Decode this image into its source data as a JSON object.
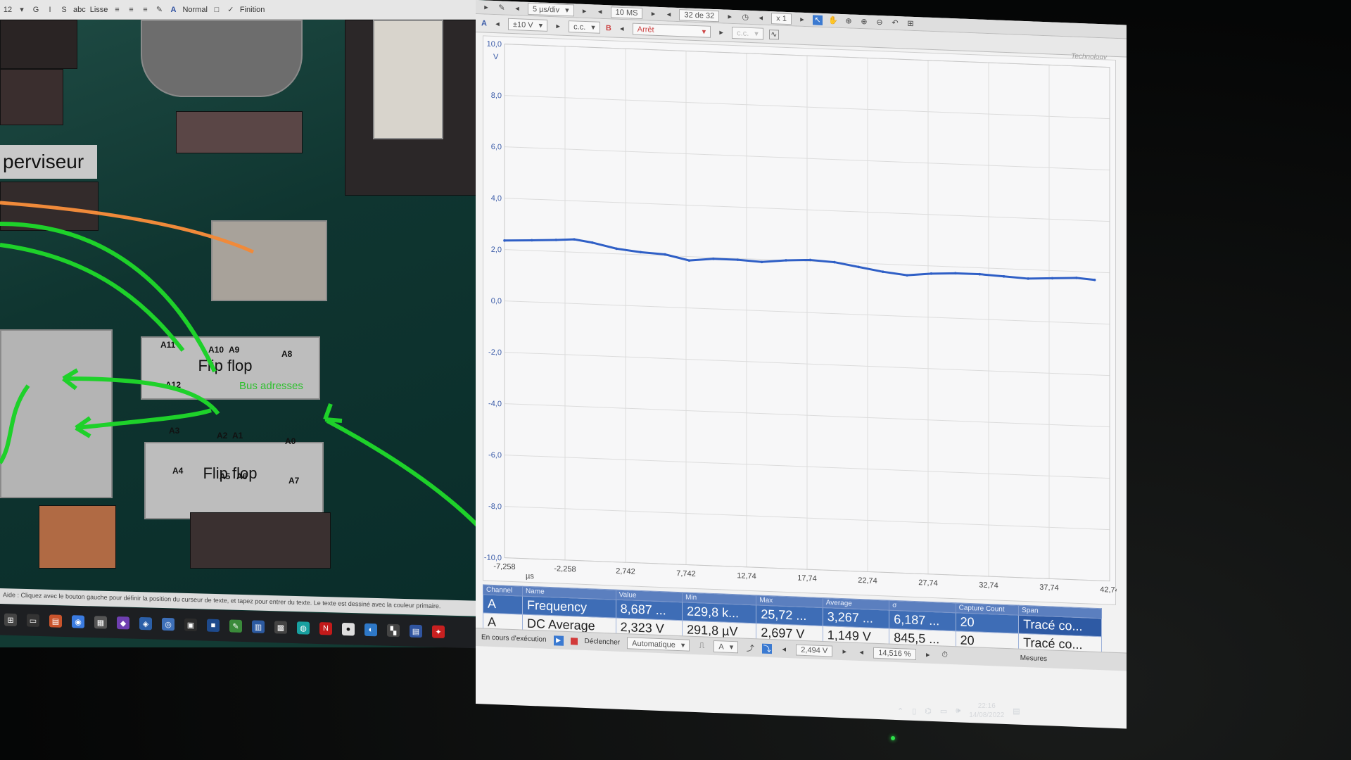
{
  "editor": {
    "toolbar": {
      "size_field": "12",
      "bold": "G",
      "italic": "I",
      "strike": "S",
      "abc": "abc",
      "smooth_label": "Lisse",
      "style_label": "Normal",
      "finish_label": "Finition"
    },
    "labels": {
      "supervisor": "perviseur",
      "flipflop_top": "Flip flop",
      "flipflop_bottom": "Flip flop",
      "bus": "Bus adresses"
    },
    "pins": [
      "A11",
      "A10",
      "A9",
      "A8",
      "A12",
      "A3",
      "A2",
      "A1",
      "A0",
      "A4",
      "A5",
      "A6",
      "A7"
    ],
    "status_text": "Aide : Cliquez avec le bouton gauche pour définir la position du curseur de texte, et tapez pour entrer du texte. Le texte est dessiné avec la couleur primaire."
  },
  "scope": {
    "toolbar1": {
      "timebase": "5 µs/div",
      "samples": "10 MS",
      "buffer": "32 de 32",
      "zoom": "x 1"
    },
    "toolbar2": {
      "channel_a": "A",
      "range_a": "±10 V",
      "coupling_a": "c.c.",
      "channel_b": "B",
      "range_b": "Arrêt",
      "coupling_b": "c.c."
    },
    "brand": "Technology",
    "chart_data": {
      "type": "line",
      "yunit": "V",
      "xunit": "µs",
      "ylim": [
        -10,
        10
      ],
      "yticks": [
        "10,0",
        "8,0",
        "6,0",
        "4,0",
        "2,0",
        "0,0",
        "-2,0",
        "-4,0",
        "-6,0",
        "-8,0",
        "-10,0"
      ],
      "xlim": [
        -7.258,
        42.74
      ],
      "xticks": [
        "-7,258",
        "-2,258",
        "2,742",
        "7,742",
        "12,74",
        "17,74",
        "22,74",
        "27,74",
        "32,74",
        "37,74",
        "42,74"
      ],
      "x": [
        -7.258,
        -5.0,
        -3.0,
        -1.5,
        0.0,
        2.0,
        4.0,
        6.0,
        8.0,
        10.0,
        12.0,
        14.0,
        16.0,
        18.0,
        20.0,
        22.0,
        24.0,
        26.0,
        28.0,
        30.0,
        32.0,
        34.0,
        36.0,
        38.0,
        40.0,
        41.5
      ],
      "series": [
        {
          "values": [
            2.35,
            2.4,
            2.45,
            2.5,
            2.4,
            2.2,
            2.1,
            2.05,
            1.85,
            1.95,
            1.95,
            1.9,
            2.0,
            2.05,
            2.0,
            1.85,
            1.7,
            1.6,
            1.7,
            1.75,
            1.75,
            1.7,
            1.65,
            1.7,
            1.75,
            1.7
          ],
          "color": "#2f5fc6"
        }
      ]
    },
    "measurements": {
      "headers": [
        "Channel",
        "Name",
        "Value",
        "Min",
        "Max",
        "Average",
        "σ",
        "Capture Count",
        "Span"
      ],
      "rows": [
        [
          "A",
          "Frequency",
          "8,687 ...",
          "229,8 k...",
          "25,72 ...",
          "3,267 ...",
          "6,187 ...",
          "20",
          "Tracé co..."
        ],
        [
          "A",
          "DC Average",
          "2,323 V",
          "291,8 µV",
          "2,697 V",
          "1,149 V",
          "845,5 ...",
          "20",
          "Tracé co..."
        ]
      ]
    },
    "status": {
      "running": "En cours d'exécution",
      "trigger": "Déclencher",
      "mode": "Automatique",
      "source": "A",
      "level": "2,494 V",
      "pretrigger": "14,516 %",
      "measures": "Mesures"
    }
  },
  "tray": {
    "time": "22:16",
    "date": "14/08/2022"
  },
  "colors": {
    "trace": "#2f5fc6",
    "arrow_green": "#1ed12a",
    "arrow_orange": "#f08a3a",
    "meas_blue": "#3e6db6"
  }
}
